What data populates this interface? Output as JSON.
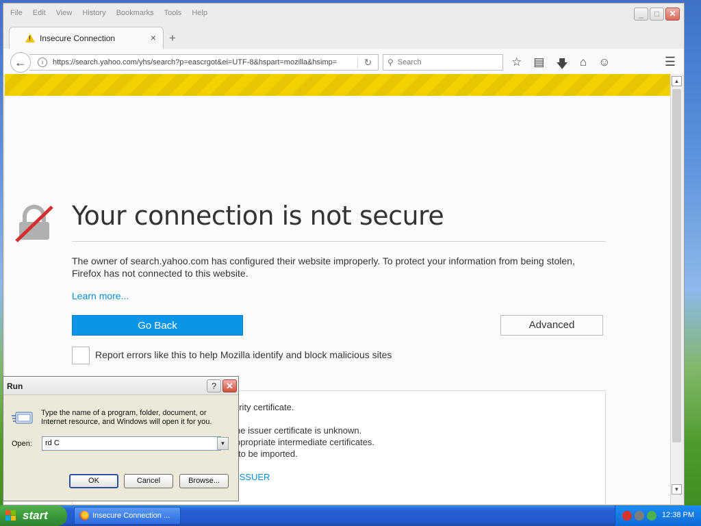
{
  "browser": {
    "menu": [
      "File",
      "Edit",
      "View",
      "History",
      "Bookmarks",
      "Tools",
      "Help"
    ],
    "window_controls": {
      "minimize": "_",
      "maximize": "□",
      "close": "✕"
    },
    "tab": {
      "title": "Insecure Connection",
      "close": "×"
    },
    "new_tab": "+",
    "url": "https://search.yahoo.com/yhs/search?p=eascrgot&ei=UTF-8&hspart=mozilla&hsimp=",
    "search_placeholder": "Search"
  },
  "error_page": {
    "title": "Your connection is not secure",
    "description": "The owner of search.yahoo.com has configured their website improperly. To protect your information from being stolen, Firefox has not connected to this website.",
    "learn_more": "Learn more...",
    "go_back": "Go Back",
    "advanced": "Advanced",
    "report_label": "Report errors like this to help Mozilla identify and block malicious sites",
    "advanced_panel": {
      "line1": "urity certificate.",
      "line2": "he issuer certificate is unknown.",
      "line3": "ppropriate intermediate certificates.",
      "line4": "to be imported.",
      "error_code": "ISSUER"
    }
  },
  "run_dialog": {
    "title": "Run",
    "help": "?",
    "close": "✕",
    "instructions": "Type the name of a program, folder, document, or Internet resource, and Windows will open it for you.",
    "open_label": "Open:",
    "open_value": "rd C",
    "ok": "OK",
    "cancel": "Cancel",
    "browse": "Browse..."
  },
  "taskbar": {
    "start": "start",
    "task_item": "Insecure Connection ...",
    "clock": "12:38 PM"
  },
  "colors": {
    "accent": "#0996e6",
    "hazard": "#f2d100",
    "link": "#0a8dd6",
    "taskbar": "#2458cc"
  }
}
